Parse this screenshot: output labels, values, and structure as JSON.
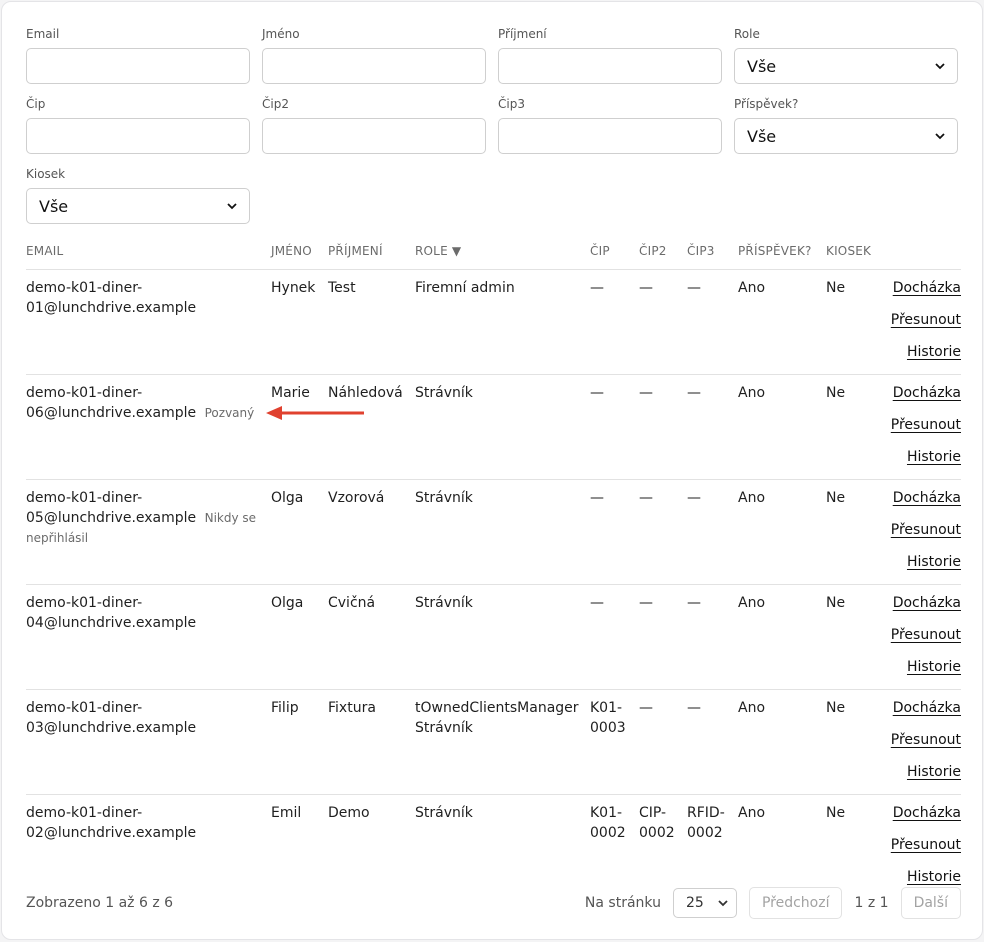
{
  "filters": {
    "email_label": "Email",
    "jmeno_label": "Jméno",
    "prijmeni_label": "Příjmení",
    "role_label": "Role",
    "role_value": "Vše",
    "cip_label": "Čip",
    "cip2_label": "Čip2",
    "cip3_label": "Čip3",
    "prispevek_label": "Příspěvek?",
    "prispevek_value": "Vše",
    "kiosek_label": "Kiosek",
    "kiosek_value": "Vše"
  },
  "table": {
    "headers": {
      "email": "EMAIL",
      "jmeno": "JMÉNO",
      "prijmeni": "PŘÍJMENÍ",
      "role": "ROLE ▼",
      "cip": "ČIP",
      "cip2": "ČIP2",
      "cip3": "ČIP3",
      "prispevek": "PŘÍSPĚVEK?",
      "kiosek": "KIOSEK"
    },
    "actions": {
      "dochazka": "Docházka",
      "presunout": "Přesunout",
      "historie": "Historie"
    },
    "rows": [
      {
        "email_a": "demo-k01-diner-",
        "email_b": "01@lunchdrive.example",
        "badge": "",
        "jmeno": "Hynek",
        "prijmeni": "Test",
        "role_a": "Firemní admin",
        "role_b": "",
        "cip_a": "—",
        "cip_b": "",
        "cip2_a": "—",
        "cip2_b": "",
        "cip3_a": "—",
        "cip3_b": "",
        "prispevek": "Ano",
        "kiosek": "Ne"
      },
      {
        "email_a": "demo-k01-diner-",
        "email_b": "06@lunchdrive.example",
        "badge": "Pozvaný",
        "jmeno": "Marie",
        "prijmeni": "Náhledová",
        "role_a": "Strávník",
        "role_b": "",
        "cip_a": "—",
        "cip_b": "",
        "cip2_a": "—",
        "cip2_b": "",
        "cip3_a": "—",
        "cip3_b": "",
        "prispevek": "Ano",
        "kiosek": "Ne"
      },
      {
        "email_a": "demo-k01-diner-",
        "email_b": "05@lunchdrive.example",
        "badge": "Nikdy se nepřihlásil",
        "jmeno": "Olga",
        "prijmeni": "Vzorová",
        "role_a": "Strávník",
        "role_b": "",
        "cip_a": "—",
        "cip_b": "",
        "cip2_a": "—",
        "cip2_b": "",
        "cip3_a": "—",
        "cip3_b": "",
        "prispevek": "Ano",
        "kiosek": "Ne"
      },
      {
        "email_a": "demo-k01-diner-",
        "email_b": "04@lunchdrive.example",
        "badge": "",
        "jmeno": "Olga",
        "prijmeni": "Cvičná",
        "role_a": "Strávník",
        "role_b": "",
        "cip_a": "—",
        "cip_b": "",
        "cip2_a": "—",
        "cip2_b": "",
        "cip3_a": "—",
        "cip3_b": "",
        "prispevek": "Ano",
        "kiosek": "Ne"
      },
      {
        "email_a": "demo-k01-diner-",
        "email_b": "03@lunchdrive.example",
        "badge": "",
        "jmeno": "Filip",
        "prijmeni": "Fixtura",
        "role_a": "tOwnedClientsManager",
        "role_b": "Strávník",
        "cip_a": "K01-",
        "cip_b": "0003",
        "cip2_a": "—",
        "cip2_b": "",
        "cip3_a": "—",
        "cip3_b": "",
        "prispevek": "Ano",
        "kiosek": "Ne"
      },
      {
        "email_a": "demo-k01-diner-",
        "email_b": "02@lunchdrive.example",
        "badge": "",
        "jmeno": "Emil",
        "prijmeni": "Demo",
        "role_a": "Strávník",
        "role_b": "",
        "cip_a": "K01-",
        "cip_b": "0002",
        "cip2_a": "CIP-",
        "cip2_b": "0002",
        "cip3_a": "RFID-",
        "cip3_b": "0002",
        "prispevek": "Ano",
        "kiosek": "Ne"
      }
    ]
  },
  "footer": {
    "showing": "Zobrazeno 1 až 6 z 6",
    "per_page_label": "Na stránku",
    "per_page_value": "25",
    "prev": "Předchozí",
    "page_info": "1 z 1",
    "next": "Další"
  },
  "colors": {
    "annotation_arrow": "#e0412f"
  },
  "icons": {
    "select_chevron": "chevron-down-icon",
    "annotation": "red-arrow-annotation"
  }
}
